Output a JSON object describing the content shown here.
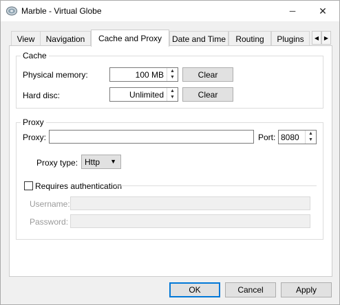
{
  "window": {
    "title": "Marble - Virtual Globe",
    "minimize_glyph": "─",
    "close_glyph": "✕"
  },
  "tabs": [
    {
      "label": "View",
      "active": false
    },
    {
      "label": "Navigation",
      "active": false
    },
    {
      "label": "Cache and Proxy",
      "active": true
    },
    {
      "label": "Date and Time",
      "active": false
    },
    {
      "label": "Routing",
      "active": false
    },
    {
      "label": "Plugins",
      "active": false
    }
  ],
  "tab_scroll": {
    "left": "◀",
    "right": "▶"
  },
  "cache": {
    "title": "Cache",
    "physical_memory_label": "Physical memory:",
    "physical_memory_value": "100 MB",
    "hard_disc_label": "Hard disc:",
    "hard_disc_value": "Unlimited",
    "clear_label": "Clear"
  },
  "proxy": {
    "title": "Proxy",
    "proxy_label": "Proxy:",
    "proxy_value": "",
    "port_label": "Port:",
    "port_value": "8080",
    "type_label": "Proxy type:",
    "type_value": "Http",
    "auth_label": "Requires authentication",
    "auth_checked": false,
    "username_label": "Username:",
    "password_label": "Password:"
  },
  "buttons": {
    "ok": "OK",
    "cancel": "Cancel",
    "apply": "Apply"
  },
  "spin_glyphs": {
    "up": "▲",
    "down": "▼"
  },
  "combo_arrow": "▼"
}
